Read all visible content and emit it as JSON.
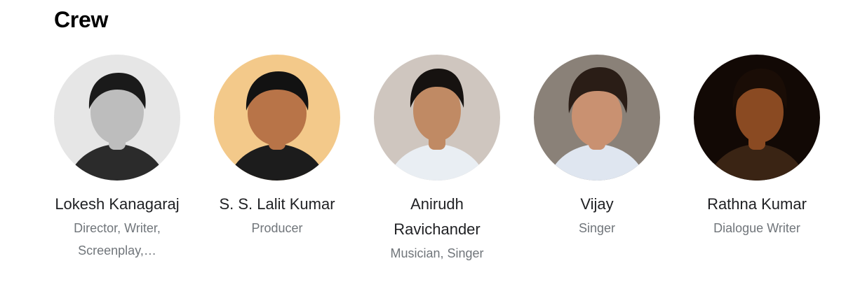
{
  "section": {
    "title": "Crew"
  },
  "crew": [
    {
      "name": "Lokesh Kanagaraj",
      "role": "Director, Writer, Screenplay,…",
      "photo_colors": {
        "bg": "#e6e6e6",
        "skin": "#bdbdbd",
        "hair": "#1a1a1a",
        "shirt": "#2b2b2b"
      }
    },
    {
      "name": "S. S. Lalit Kumar",
      "role": "Producer",
      "photo_colors": {
        "bg": "#f3c98a",
        "skin": "#b87448",
        "hair": "#121212",
        "shirt": "#1c1c1c"
      }
    },
    {
      "name": "Anirudh Ravichander",
      "role": "Musician, Singer",
      "photo_colors": {
        "bg": "#cfc6bf",
        "skin": "#c08a64",
        "hair": "#161210",
        "shirt": "#e9eef3"
      }
    },
    {
      "name": "Vijay",
      "role": "Singer",
      "photo_colors": {
        "bg": "#8a8178",
        "skin": "#c99171",
        "hair": "#2a1d16",
        "shirt": "#dfe6f0"
      }
    },
    {
      "name": "Rathna Kumar",
      "role": "Dialogue Writer",
      "photo_colors": {
        "bg": "#120905",
        "skin": "#8a4a22",
        "hair": "#1a0d06",
        "shirt": "#3a2414"
      }
    }
  ]
}
